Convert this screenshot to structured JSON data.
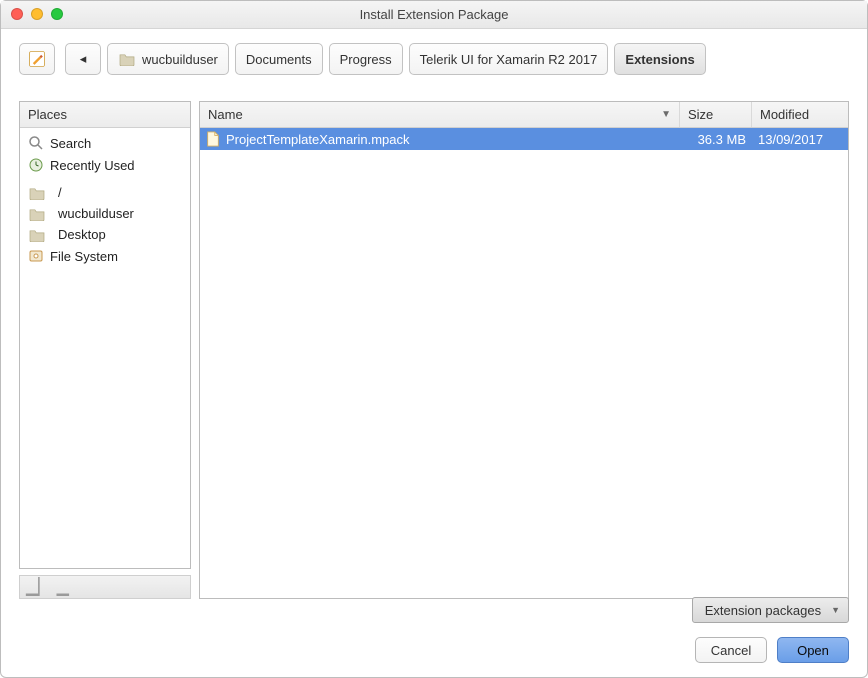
{
  "title": "Install Extension Package",
  "breadcrumb": {
    "back": "◂",
    "items": [
      {
        "label": "wucbuilduser",
        "icon": "folder"
      },
      {
        "label": "Documents"
      },
      {
        "label": "Progress"
      },
      {
        "label": "Telerik UI for Xamarin R2 2017"
      },
      {
        "label": "Extensions",
        "active": true
      }
    ]
  },
  "sidebar": {
    "header": "Places",
    "groups": [
      [
        {
          "label": "Search",
          "icon": "search"
        },
        {
          "label": "Recently Used",
          "icon": "clock"
        }
      ],
      [
        {
          "label": "/",
          "icon": "folder"
        },
        {
          "label": "wucbuilduser",
          "icon": "folder"
        },
        {
          "label": "Desktop",
          "icon": "folder"
        },
        {
          "label": "File System",
          "icon": "drive"
        }
      ]
    ]
  },
  "filelist": {
    "columns": {
      "name": "Name",
      "size": "Size",
      "modified": "Modified"
    },
    "rows": [
      {
        "name": "ProjectTemplateXamarin.mpack",
        "size": "36.3 MB",
        "modified": "13/09/2017",
        "selected": true
      }
    ]
  },
  "filter": {
    "label": "Extension packages"
  },
  "actions": {
    "cancel": "Cancel",
    "open": "Open"
  }
}
